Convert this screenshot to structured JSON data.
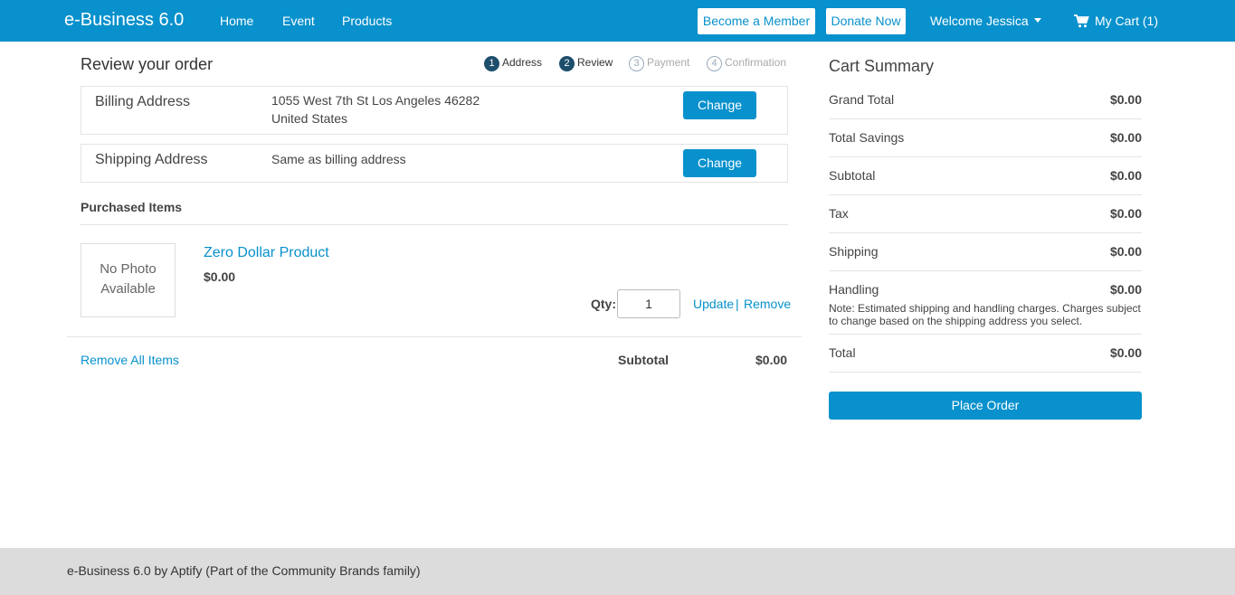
{
  "header": {
    "brand": "e-Business 6.0",
    "nav": [
      "Home",
      "Event",
      "Products"
    ],
    "become_member": "Become a Member",
    "donate": "Donate Now",
    "welcome": "Welcome Jessica",
    "cart": "My Cart (1)"
  },
  "review": {
    "title": "Review your order",
    "steps": [
      {
        "num": "1",
        "label": "Address",
        "state": "done"
      },
      {
        "num": "2",
        "label": "Review",
        "state": "done"
      },
      {
        "num": "3",
        "label": "Payment",
        "state": "todo"
      },
      {
        "num": "4",
        "label": "Confirmation",
        "state": "todo"
      }
    ],
    "billing": {
      "label": "Billing Address",
      "line1": "1055 West 7th St Los Angeles 46282",
      "line2": "United States",
      "button": "Change"
    },
    "shipping": {
      "label": "Shipping Address",
      "text": "Same as billing address",
      "button": "Change"
    },
    "purchased_heading": "Purchased Items",
    "item": {
      "photo_line1": "No Photo",
      "photo_line2": "Available",
      "name": "Zero Dollar Product",
      "price": "$0.00",
      "qty_label": "Qty:",
      "qty": "1",
      "update": "Update",
      "separator": "|",
      "remove": "Remove"
    },
    "remove_all": "Remove All Items",
    "subtotal_label": "Subtotal",
    "subtotal_value": "$0.00"
  },
  "summary": {
    "title": "Cart Summary",
    "rows": [
      {
        "label": "Grand Total",
        "value": "$0.00"
      },
      {
        "label": "Total Savings",
        "value": "$0.00"
      },
      {
        "label": "Subtotal",
        "value": "$0.00"
      },
      {
        "label": "Tax",
        "value": "$0.00"
      },
      {
        "label": "Shipping",
        "value": "$0.00"
      },
      {
        "label": "Handling",
        "value": "$0.00"
      },
      {
        "label": "Total",
        "value": "$0.00"
      }
    ],
    "handling_note": "Note: Estimated shipping and handling charges. Charges subject to change based on the shipping address you select.",
    "place_order": "Place Order"
  },
  "footer": {
    "text": "e-Business 6.0 by Aptify (Part of the Community Brands family)"
  },
  "colors": {
    "primary": "#0891cc",
    "step_done": "#1d4e6b",
    "footer_bg": "#dcdcdc"
  }
}
